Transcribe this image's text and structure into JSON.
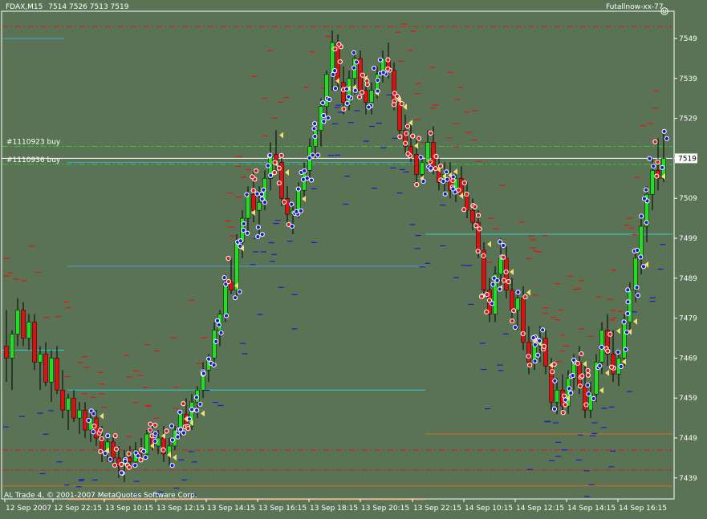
{
  "header": {
    "symbol": "FDAX,M15",
    "ohlc": "7514 7526 7513 7519",
    "indicator": "Futallnow-xx-77",
    "smile_icon": "smiley-face-icon"
  },
  "footer": {
    "copyright": "AL Trade 4, © 2001-2007 MetaQuotes Software Corp."
  },
  "orders": [
    {
      "label": "#1110923 buy",
      "price": 7522
    },
    {
      "label": "#1110936 buy",
      "price": 7517.5
    }
  ],
  "chart_data": {
    "type": "candlestick",
    "title": "FDAX,M15",
    "ylim": [
      7434,
      7553
    ],
    "y_ticks": [
      7549,
      7539,
      7529,
      7519,
      7509,
      7499,
      7489,
      7479,
      7469,
      7459,
      7449,
      7439
    ],
    "current_price": 7519,
    "x_ticks": [
      "12 Sep 2007",
      "12 Sep 22:15",
      "13 Sep 10:15",
      "13 Sep 12:15",
      "13 Sep 14:15",
      "13 Sep 16:15",
      "13 Sep 18:15",
      "13 Sep 20:15",
      "13 Sep 22:15",
      "14 Sep 10:15",
      "14 Sep 12:15",
      "14 Sep 14:15",
      "14 Sep 16:15"
    ],
    "grid": false,
    "candles": [
      [
        7472,
        7481,
        7463,
        7469
      ],
      [
        7469,
        7476,
        7461,
        7475
      ],
      [
        7475,
        7484,
        7472,
        7481
      ],
      [
        7481,
        7483,
        7472,
        7474
      ],
      [
        7474,
        7480,
        7471,
        7478
      ],
      [
        7478,
        7480,
        7466,
        7468
      ],
      [
        7468,
        7472,
        7461,
        7470
      ],
      [
        7470,
        7473,
        7462,
        7463
      ],
      [
        7463,
        7471,
        7458,
        7469
      ],
      [
        7469,
        7472,
        7460,
        7461
      ],
      [
        7461,
        7466,
        7454,
        7456
      ],
      [
        7456,
        7460,
        7451,
        7459
      ],
      [
        7459,
        7461,
        7453,
        7454
      ],
      [
        7454,
        7458,
        7450,
        7456
      ],
      [
        7456,
        7458,
        7449,
        7451
      ],
      [
        7451,
        7456,
        7448,
        7454
      ],
      [
        7454,
        7456,
        7447,
        7449
      ],
      [
        7449,
        7452,
        7443,
        7446
      ],
      [
        7446,
        7450,
        7443,
        7448
      ],
      [
        7448,
        7450,
        7442,
        7444
      ],
      [
        7444,
        7447,
        7439,
        7442
      ],
      [
        7442,
        7446,
        7438,
        7444
      ],
      [
        7444,
        7447,
        7441,
        7443
      ],
      [
        7443,
        7448,
        7442,
        7446
      ],
      [
        7446,
        7449,
        7443,
        7445
      ],
      [
        7445,
        7451,
        7444,
        7450
      ],
      [
        7450,
        7453,
        7446,
        7447
      ],
      [
        7447,
        7451,
        7445,
        7449
      ],
      [
        7449,
        7452,
        7443,
        7445
      ],
      [
        7445,
        7449,
        7442,
        7447
      ],
      [
        7447,
        7452,
        7446,
        7451
      ],
      [
        7451,
        7456,
        7449,
        7455
      ],
      [
        7455,
        7459,
        7451,
        7452
      ],
      [
        7452,
        7460,
        7451,
        7458
      ],
      [
        7458,
        7462,
        7454,
        7461
      ],
      [
        7461,
        7468,
        7459,
        7466
      ],
      [
        7466,
        7470,
        7463,
        7469
      ],
      [
        7469,
        7478,
        7467,
        7476
      ],
      [
        7476,
        7481,
        7472,
        7480
      ],
      [
        7480,
        7490,
        7478,
        7488
      ],
      [
        7488,
        7494,
        7485,
        7486
      ],
      [
        7486,
        7500,
        7484,
        7498
      ],
      [
        7498,
        7506,
        7494,
        7504
      ],
      [
        7504,
        7512,
        7500,
        7510
      ],
      [
        7510,
        7516,
        7503,
        7506
      ],
      [
        7506,
        7512,
        7499,
        7508
      ],
      [
        7508,
        7516,
        7506,
        7514
      ],
      [
        7514,
        7523,
        7511,
        7520
      ],
      [
        7520,
        7526,
        7515,
        7518
      ],
      [
        7518,
        7520,
        7507,
        7509
      ],
      [
        7509,
        7512,
        7502,
        7505
      ],
      [
        7505,
        7508,
        7500,
        7506
      ],
      [
        7506,
        7513,
        7504,
        7511
      ],
      [
        7511,
        7518,
        7509,
        7516
      ],
      [
        7516,
        7524,
        7513,
        7522
      ],
      [
        7522,
        7528,
        7519,
        7526
      ],
      [
        7526,
        7534,
        7522,
        7532
      ],
      [
        7532,
        7541,
        7529,
        7540
      ],
      [
        7540,
        7551,
        7536,
        7548
      ],
      [
        7548,
        7550,
        7536,
        7538
      ],
      [
        7538,
        7542,
        7530,
        7533
      ],
      [
        7533,
        7541,
        7531,
        7539
      ],
      [
        7539,
        7546,
        7535,
        7544
      ],
      [
        7544,
        7546,
        7534,
        7536
      ],
      [
        7536,
        7540,
        7530,
        7533
      ],
      [
        7533,
        7538,
        7530,
        7536
      ],
      [
        7536,
        7542,
        7534,
        7540
      ],
      [
        7540,
        7546,
        7538,
        7544
      ],
      [
        7544,
        7548,
        7539,
        7541
      ],
      [
        7541,
        7543,
        7531,
        7533
      ],
      [
        7533,
        7535,
        7524,
        7526
      ],
      [
        7526,
        7530,
        7520,
        7522
      ],
      [
        7522,
        7528,
        7518,
        7520
      ],
      [
        7520,
        7524,
        7512,
        7515
      ],
      [
        7515,
        7520,
        7513,
        7518
      ],
      [
        7518,
        7526,
        7516,
        7523
      ],
      [
        7523,
        7527,
        7515,
        7517
      ],
      [
        7517,
        7519,
        7511,
        7513
      ],
      [
        7513,
        7518,
        7510,
        7515
      ],
      [
        7515,
        7518,
        7509,
        7511
      ],
      [
        7511,
        7516,
        7508,
        7514
      ],
      [
        7514,
        7517,
        7509,
        7510
      ],
      [
        7510,
        7513,
        7504,
        7506
      ],
      [
        7506,
        7509,
        7501,
        7503
      ],
      [
        7503,
        7506,
        7494,
        7496
      ],
      [
        7496,
        7498,
        7484,
        7486
      ],
      [
        7486,
        7489,
        7478,
        7480
      ],
      [
        7480,
        7492,
        7478,
        7490
      ],
      [
        7490,
        7499,
        7486,
        7494
      ],
      [
        7494,
        7497,
        7484,
        7486
      ],
      [
        7486,
        7489,
        7478,
        7481
      ],
      [
        7481,
        7486,
        7476,
        7484
      ],
      [
        7484,
        7487,
        7471,
        7473
      ],
      [
        7473,
        7477,
        7465,
        7468
      ],
      [
        7468,
        7475,
        7466,
        7472
      ],
      [
        7472,
        7477,
        7468,
        7474
      ],
      [
        7474,
        7476,
        7465,
        7467
      ],
      [
        7467,
        7469,
        7456,
        7458
      ],
      [
        7458,
        7464,
        7455,
        7461
      ],
      [
        7461,
        7465,
        7455,
        7457
      ],
      [
        7457,
        7466,
        7455,
        7464
      ],
      [
        7464,
        7470,
        7461,
        7468
      ],
      [
        7468,
        7472,
        7460,
        7462
      ],
      [
        7462,
        7467,
        7454,
        7456
      ],
      [
        7456,
        7463,
        7454,
        7460
      ],
      [
        7460,
        7470,
        7458,
        7468
      ],
      [
        7468,
        7478,
        7465,
        7476
      ],
      [
        7476,
        7480,
        7467,
        7470
      ],
      [
        7470,
        7476,
        7463,
        7465
      ],
      [
        7465,
        7471,
        7462,
        7469
      ],
      [
        7469,
        7480,
        7467,
        7478
      ],
      [
        7478,
        7488,
        7475,
        7486
      ],
      [
        7486,
        7496,
        7483,
        7494
      ],
      [
        7494,
        7505,
        7490,
        7502
      ],
      [
        7502,
        7512,
        7498,
        7510
      ],
      [
        7510,
        7519,
        7506,
        7516
      ],
      [
        7516,
        7524,
        7511,
        7514
      ],
      [
        7514,
        7526,
        7513,
        7519
      ]
    ],
    "horizontal_levels": [
      {
        "price": 7549,
        "color": "#4a9fd8",
        "style": "solid"
      },
      {
        "price": 7518,
        "color": "#4a9fd8",
        "style": "solid"
      },
      {
        "price": 7492,
        "color": "#4a9fd8",
        "style": "solid"
      },
      {
        "price": 7500,
        "color": "#28d0d8",
        "style": "solid"
      },
      {
        "price": 7471,
        "color": "#28d0d8",
        "style": "solid"
      },
      {
        "price": 7461,
        "color": "#28d0d8",
        "style": "solid"
      },
      {
        "price": 7450,
        "color": "#d07020",
        "style": "solid"
      },
      {
        "price": 7437,
        "color": "#d07020",
        "style": "solid"
      },
      {
        "price": 7433.5,
        "color": "#d07020",
        "style": "solid"
      },
      {
        "price": 7552,
        "color": "#cc2222",
        "style": "dashdot"
      },
      {
        "price": 7446,
        "color": "#cc2222",
        "style": "dashdot"
      },
      {
        "price": 7441,
        "color": "#cc2222",
        "style": "dashdot"
      },
      {
        "price": 7522,
        "color": "#2ad02a",
        "style": "dashdot"
      },
      {
        "price": 7517.5,
        "color": "#2ad02a",
        "style": "dashdot"
      },
      {
        "price": 7519,
        "color": "#ffffff",
        "style": "solid"
      }
    ],
    "colors": {
      "background": "#5a7355",
      "bull": "#22dd22",
      "bear": "#dd1111",
      "axis": "#ffffff",
      "marker_blue": "#1a1acc",
      "marker_red": "#e01515",
      "marker_yellow": "#f0e070"
    }
  }
}
